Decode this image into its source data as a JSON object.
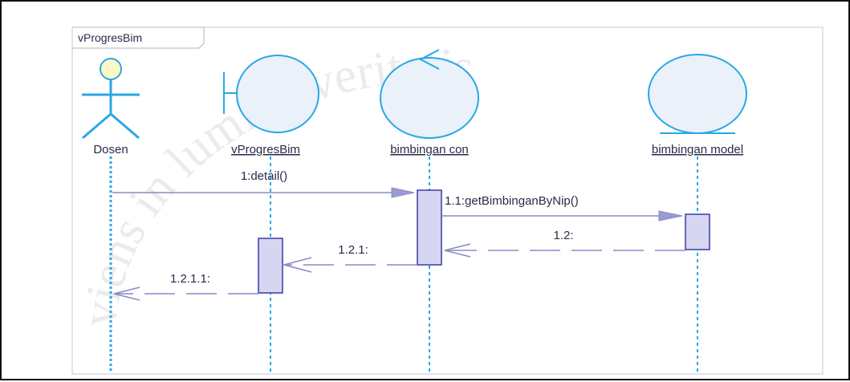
{
  "frame": {
    "title": "vProgresBim"
  },
  "lifelines": [
    {
      "name": "Dosen",
      "kind": "actor",
      "underlined": false
    },
    {
      "name": "vProgresBim",
      "kind": "boundary",
      "underlined": true
    },
    {
      "name": "bimbingan con",
      "kind": "control",
      "underlined": true
    },
    {
      "name": "bimbingan model",
      "kind": "entity",
      "underlined": true
    }
  ],
  "messages": [
    {
      "label": "1:detail()",
      "from": "Dosen",
      "to": "bimbingan con",
      "type": "call"
    },
    {
      "label": "1.1:getBimbinganByNip()",
      "from": "bimbingan con",
      "to": "bimbingan model",
      "type": "call"
    },
    {
      "label": "1.2:",
      "from": "bimbingan model",
      "to": "bimbingan con",
      "type": "return"
    },
    {
      "label": "1.2.1:",
      "from": "bimbingan con",
      "to": "vProgresBim",
      "type": "return"
    },
    {
      "label": "1.2.1.1:",
      "from": "vProgresBim",
      "to": "Dosen",
      "type": "return"
    }
  ],
  "watermark": {
    "text": "viens in lumine veritatis"
  },
  "colors": {
    "actor_stroke": "#2aa7e6",
    "actor_head_fill": "#fdf8c8",
    "object_stroke": "#2aa7e6",
    "object_fill": "#eaf1f8",
    "lifeline": "#2aa7e6",
    "activation_stroke": "#3a3aa0",
    "activation_fill": "#d6d6f2",
    "message": "#8a8ac6",
    "arrowhead": "#9a9ad6"
  }
}
